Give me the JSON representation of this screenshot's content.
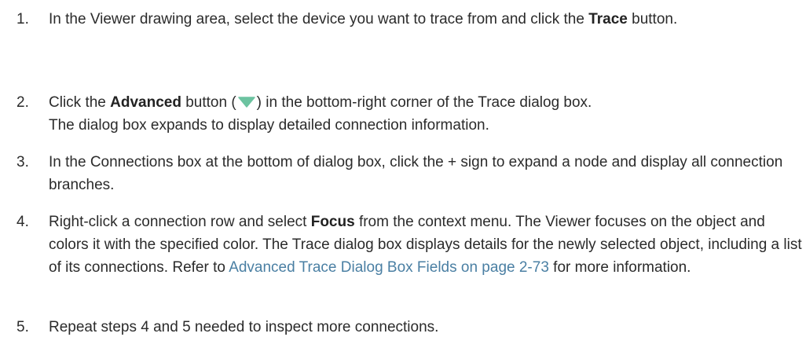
{
  "steps": [
    {
      "number": "1.",
      "text_before": "In the Viewer drawing area, select the device you want to trace from and click the ",
      "bold": "Trace",
      "text_after": " button."
    },
    {
      "number": "2.",
      "text_before": "Click the ",
      "bold": "Advanced",
      "text_mid_before": " button (",
      "icon": "triangle-down-icon",
      "icon_color": "#6cc3a0",
      "text_after": ") in the bottom-right corner of the Trace dialog box.",
      "line2": "The dialog box expands to display detailed connection information."
    },
    {
      "number": "3.",
      "text": "In the Connections box at the bottom of dialog box, click the + sign to expand a node and display all connection branches."
    },
    {
      "number": "4.",
      "text_before": "Right-click a connection row and select ",
      "bold": "Focus",
      "text_after": " from the context menu. The Viewer focuses on the object and colors it with the specified color. The Trace dialog box displays details for the newly selected object, including a list of its connections. Refer to ",
      "link": "Advanced Trace Dialog Box Fields on page 2-73",
      "text_end": " for more information."
    },
    {
      "number": "5.",
      "text": "Repeat steps 4 and 5 needed to inspect more connections."
    }
  ],
  "colors": {
    "text": "#2b2b2b",
    "link": "#4a7fa3",
    "icon": "#6cc3a0"
  }
}
